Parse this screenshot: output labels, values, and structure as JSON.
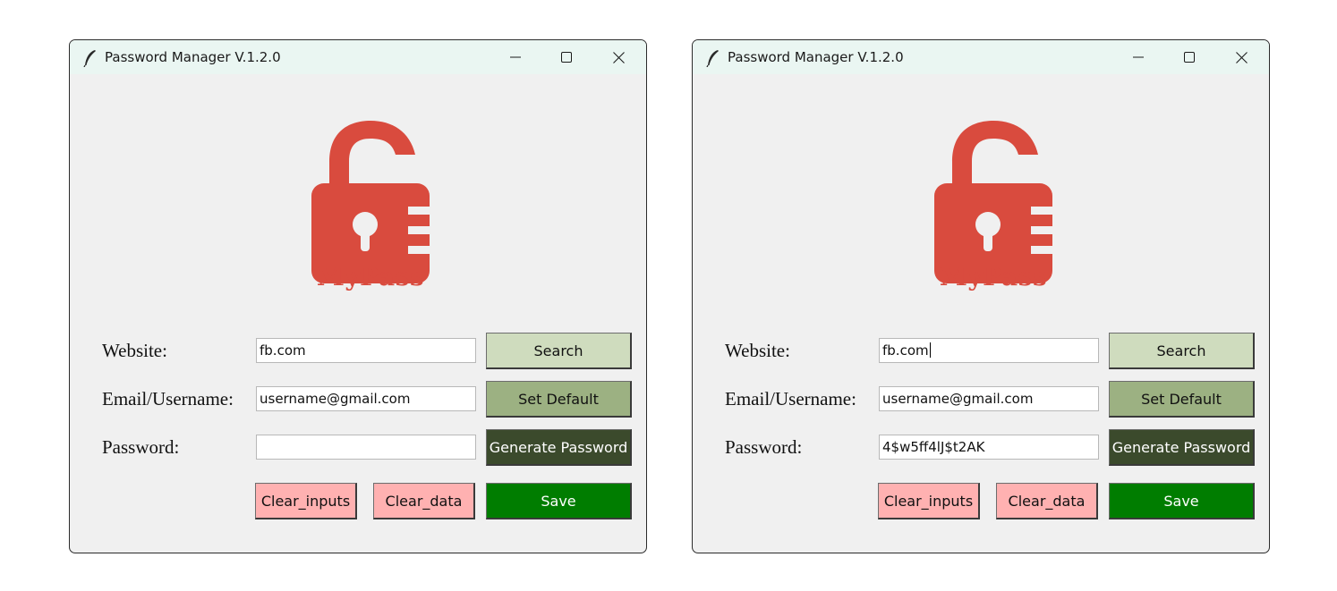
{
  "colors": {
    "brand": "#d94b3e",
    "search_button": "#cfdcbe",
    "set_default_button": "#9cb182",
    "generate_button": "#3b4a2c",
    "clear_buttons": "#ffb1b1",
    "save_button": "#007d00"
  },
  "windows": [
    {
      "title": "Password Manager V.1.2.0",
      "title_icon": "feather-icon",
      "controls": [
        "minimize-icon",
        "maximize-icon",
        "close-icon"
      ],
      "logo_text": "MyPass",
      "website_label": "Website:",
      "email_label": "Email/Username:",
      "password_label": "Password:",
      "website_value": "fb.com",
      "email_value": "username@gmail.com",
      "password_value": "",
      "search_label": "Search",
      "set_default_label": "Set Default",
      "generate_label": "Generate Password",
      "clear_inputs_label": "Clear_inputs",
      "clear_data_label": "Clear_data",
      "save_label": "Save"
    },
    {
      "title": "Password Manager V.1.2.0",
      "title_icon": "feather-icon",
      "controls": [
        "minimize-icon",
        "maximize-icon",
        "close-icon"
      ],
      "logo_text": "MyPass",
      "website_label": "Website:",
      "email_label": "Email/Username:",
      "password_label": "Password:",
      "website_value": "fb.com",
      "email_value": "username@gmail.com",
      "password_value": "4$w5ff4lJ$t2AK",
      "search_label": "Search",
      "set_default_label": "Set Default",
      "generate_label": "Generate Password",
      "clear_inputs_label": "Clear_inputs",
      "clear_data_label": "Clear_data",
      "save_label": "Save"
    }
  ]
}
